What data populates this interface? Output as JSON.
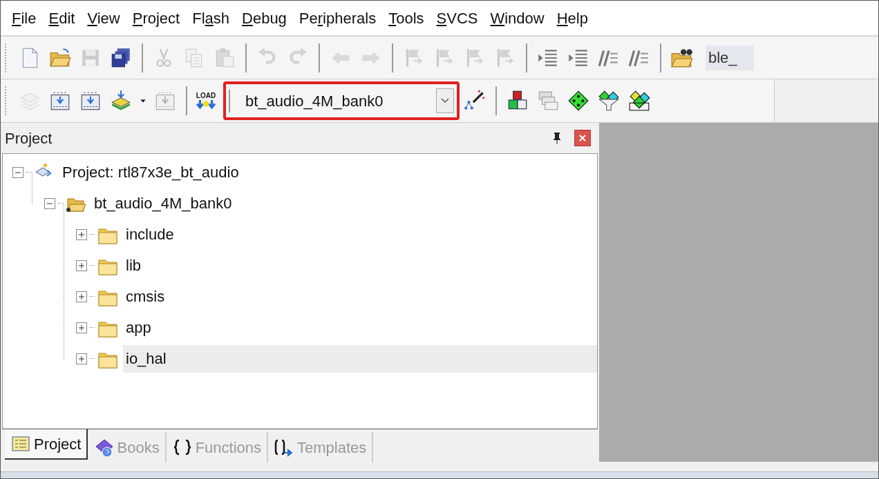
{
  "menu": [
    {
      "key": "F",
      "post": "ile"
    },
    {
      "key": "E",
      "post": "dit"
    },
    {
      "key": "V",
      "post": "iew"
    },
    {
      "key": "P",
      "post": "roject"
    },
    {
      "pre": "Fl",
      "key": "a",
      "post": "sh"
    },
    {
      "key": "D",
      "post": "ebug"
    },
    {
      "pre": "Pe",
      "key": "r",
      "post": "ipherals"
    },
    {
      "key": "T",
      "post": "ools"
    },
    {
      "key": "S",
      "post": "VCS"
    },
    {
      "key": "W",
      "post": "indow"
    },
    {
      "key": "H",
      "post": "elp"
    }
  ],
  "toolbar_1": [
    {
      "kind": "new",
      "disabled": false
    },
    {
      "kind": "open",
      "disabled": false
    },
    {
      "kind": "save",
      "disabled": true
    },
    {
      "kind": "save-all",
      "disabled": false
    },
    {
      "kind": "sep"
    },
    {
      "kind": "cut",
      "disabled": true
    },
    {
      "kind": "copy",
      "disabled": true
    },
    {
      "kind": "paste",
      "disabled": true
    },
    {
      "kind": "sep"
    },
    {
      "kind": "undo",
      "disabled": true
    },
    {
      "kind": "redo",
      "disabled": true
    },
    {
      "kind": "sep"
    },
    {
      "kind": "back",
      "disabled": true
    },
    {
      "kind": "forward",
      "disabled": true
    },
    {
      "kind": "sep"
    },
    {
      "kind": "flag",
      "disabled": true
    },
    {
      "kind": "flag",
      "disabled": true
    },
    {
      "kind": "flag",
      "disabled": true
    },
    {
      "kind": "flag",
      "disabled": true
    },
    {
      "kind": "sep"
    },
    {
      "kind": "indent",
      "disabled": false
    },
    {
      "kind": "indent",
      "disabled": false
    },
    {
      "kind": "comment",
      "disabled": false
    },
    {
      "kind": "comment",
      "disabled": false
    },
    {
      "kind": "sep"
    },
    {
      "kind": "folder-find",
      "disabled": false
    },
    {
      "kind": "field",
      "value": "ble_"
    }
  ],
  "toolbar_2": [
    {
      "kind": "stack",
      "disabled": true
    },
    {
      "kind": "build",
      "disabled": false
    },
    {
      "kind": "build",
      "disabled": false
    },
    {
      "kind": "batch",
      "disabled": false
    },
    {
      "kind": "caret",
      "disabled": false
    },
    {
      "kind": "build",
      "disabled": true
    },
    {
      "kind": "sep"
    },
    {
      "kind": "load",
      "disabled": false,
      "text": "LOAD"
    },
    {
      "kind": "target",
      "value": "bt_audio_4M_bank0",
      "highlighted": true
    },
    {
      "kind": "wand",
      "disabled": false
    },
    {
      "kind": "sep"
    },
    {
      "kind": "blocks",
      "disabled": false
    },
    {
      "kind": "windows",
      "disabled": false
    },
    {
      "kind": "diamond",
      "disabled": false
    },
    {
      "kind": "funnel",
      "disabled": false
    },
    {
      "kind": "multi",
      "disabled": false
    }
  ],
  "panel": {
    "title": "Project",
    "tree": [
      {
        "label": "Project: rtl87x3e_bt_audio",
        "kind": "project",
        "expanded": true,
        "selected": false,
        "children": [
          {
            "label": "bt_audio_4M_bank0",
            "kind": "target",
            "expanded": true,
            "selected": false,
            "children": [
              {
                "label": "include",
                "kind": "group",
                "expanded": false,
                "selected": false
              },
              {
                "label": "lib",
                "kind": "group",
                "expanded": false,
                "selected": false
              },
              {
                "label": "cmsis",
                "kind": "group",
                "expanded": false,
                "selected": false
              },
              {
                "label": "app",
                "kind": "group",
                "expanded": false,
                "selected": false
              },
              {
                "label": "io_hal",
                "kind": "group",
                "expanded": false,
                "selected": true
              }
            ]
          }
        ]
      }
    ],
    "tabs": [
      {
        "label": "Project",
        "kind": "project",
        "selected": true
      },
      {
        "label": "Books",
        "kind": "books",
        "selected": false
      },
      {
        "label": "Functions",
        "kind": "functions",
        "selected": false
      },
      {
        "label": "Templates",
        "kind": "templates",
        "selected": false
      }
    ]
  }
}
